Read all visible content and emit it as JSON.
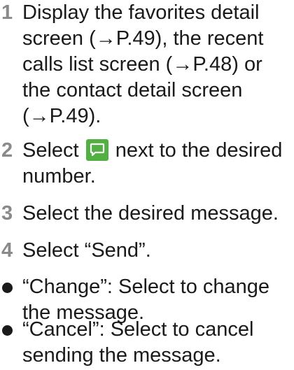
{
  "steps": [
    {
      "number": "1",
      "lines": [
        "Display the favorites detail",
        "screen (→P.49), the recent",
        "calls list screen (→P.48) or",
        "the contact detail screen",
        "(→P.49)."
      ]
    },
    {
      "number": "2",
      "line1_before_icon": "Select",
      "icon": "message-bubble-icon",
      "line1_after_icon": "next to the desired",
      "line2": "number."
    },
    {
      "number": "3",
      "lines": [
        "Select the desired message."
      ]
    },
    {
      "number": "4",
      "lines": [
        "Select “Send”."
      ]
    }
  ],
  "notes": [
    {
      "lines": [
        "“Change”: Select to change",
        "the message."
      ]
    },
    {
      "lines": [
        "“Cancel”: Select to cancel",
        "sending the message."
      ]
    }
  ],
  "colors": {
    "step_number": "#8a8a8a",
    "text": "#1a1a1a",
    "icon_background": "#52b043"
  }
}
